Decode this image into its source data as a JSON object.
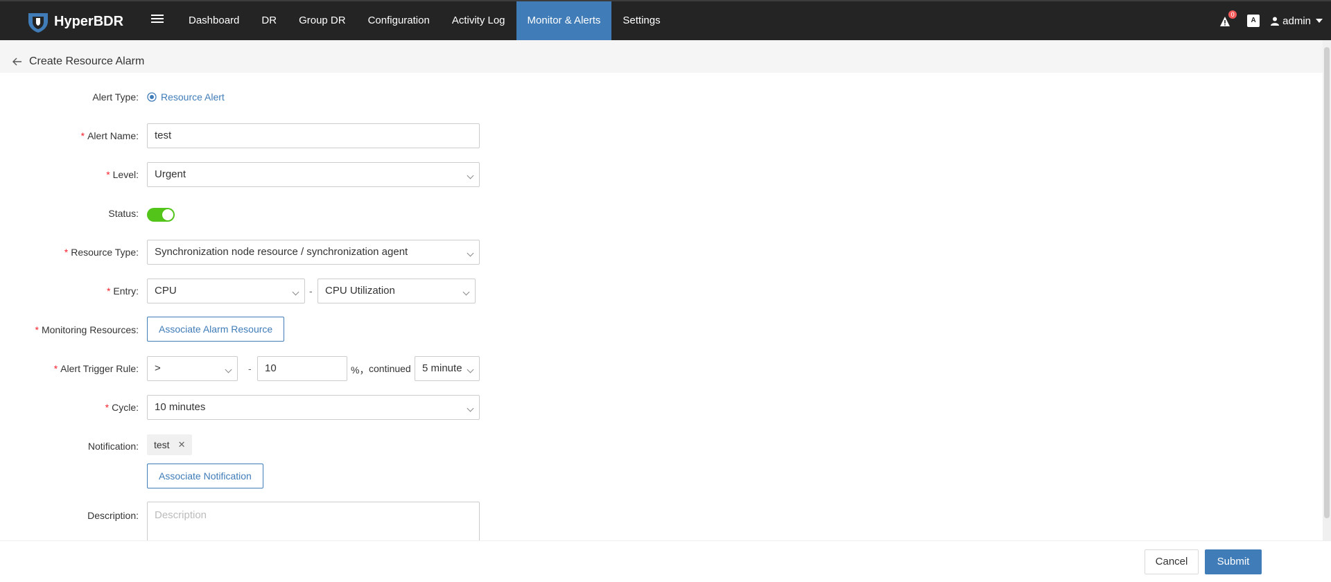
{
  "app": {
    "name": "HyperBDR"
  },
  "nav": {
    "items": [
      "Dashboard",
      "DR",
      "Group DR",
      "Configuration",
      "Activity Log",
      "Monitor & Alerts",
      "Settings"
    ],
    "active": "Monitor & Alerts"
  },
  "header_right": {
    "alert_count": "0",
    "lang_icon": "A",
    "user": "admin"
  },
  "page": {
    "title": "Create Resource Alarm"
  },
  "form": {
    "alert_type_label": "Alert Type:",
    "alert_type_value": "Resource Alert",
    "alert_name_label": "Alert Name:",
    "alert_name_value": "test",
    "level_label": "Level:",
    "level_value": "Urgent",
    "status_label": "Status:",
    "status_on": true,
    "resource_type_label": "Resource Type:",
    "resource_type_value": "Synchronization node resource / synchronization agent",
    "entry_label": "Entry:",
    "entry_value": "CPU",
    "entry_sep": "-",
    "entry_metric": "CPU Utilization",
    "monitoring_label": "Monitoring Resources:",
    "monitoring_button": "Associate Alarm Resource",
    "trigger_label": "Alert Trigger Rule:",
    "trigger_operator": ">",
    "trigger_sep": "-",
    "trigger_value": "10",
    "trigger_unit": "%，",
    "trigger_continued": "continued",
    "trigger_duration": "5 minute",
    "cycle_label": "Cycle:",
    "cycle_value": "10 minutes",
    "notification_label": "Notification:",
    "notification_tag": "test",
    "notification_button": "Associate Notification",
    "description_label": "Description:",
    "description_placeholder": "Description"
  },
  "footer": {
    "cancel": "Cancel",
    "submit": "Submit"
  },
  "colors": {
    "primary": "#3f7cb8",
    "topbar": "#242424",
    "required": "#f5222d",
    "toggle_on": "#52c41a",
    "badge": "#f25a5a"
  }
}
